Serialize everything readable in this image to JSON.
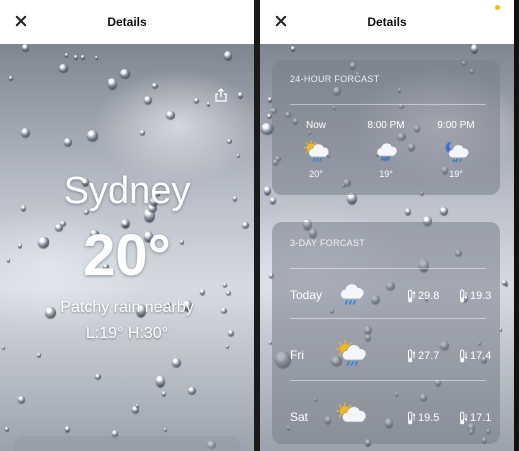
{
  "screens": {
    "left": {
      "header": {
        "title": "Details",
        "close_icon": "close-icon"
      },
      "city": "Sydney",
      "temperature": "20°",
      "condition": "Patchy rain nearby",
      "low_high": "L:19° H:30°"
    },
    "right": {
      "header": {
        "title": "Details",
        "close_icon": "close-icon"
      },
      "hourly": {
        "title": "24-HOUR FORCAST",
        "items": [
          {
            "time": "Now",
            "icon": "sun-cloud-rain-icon",
            "temp": "20°"
          },
          {
            "time": "8:00 PM",
            "icon": "cloud-rain-icon",
            "temp": "19°"
          },
          {
            "time": "9:00 PM",
            "icon": "moon-cloud-rain-icon",
            "temp": "19°"
          }
        ]
      },
      "daily": {
        "title": "3-DAY FORCAST",
        "rows": [
          {
            "day": "Today",
            "icon": "cloud-rain-icon",
            "high": "29.8",
            "low": "19.3"
          },
          {
            "day": "Fri",
            "icon": "sun-cloud-rain-icon",
            "high": "27.7",
            "low": "17.4"
          },
          {
            "day": "Sat",
            "icon": "sun-cloud-icon",
            "high": "19.5",
            "low": "17.1"
          }
        ]
      }
    }
  },
  "colors": {
    "status_dot": "#f2c200",
    "card_bg": "rgba(120,126,138,0.55)"
  }
}
